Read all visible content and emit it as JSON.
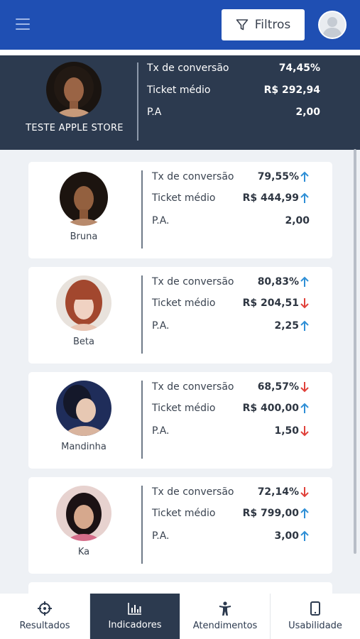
{
  "header": {
    "filter_label": "Filtros"
  },
  "store": {
    "name": "TESTE APPLE STORE",
    "metrics": [
      {
        "label": "Tx de conversão",
        "value": "74,45%"
      },
      {
        "label": "Ticket médio",
        "value": "R$ 292,94"
      },
      {
        "label": "P.A",
        "value": "2,00"
      }
    ]
  },
  "sellers": [
    {
      "name": "Bruna",
      "metrics": [
        {
          "label": "Tx de conversão",
          "value": "79,55%",
          "trend": "up"
        },
        {
          "label": "Ticket médio",
          "value": "R$ 444,99",
          "trend": "up"
        },
        {
          "label": "P.A.",
          "value": "2,00",
          "trend": "none"
        }
      ]
    },
    {
      "name": "Beta",
      "metrics": [
        {
          "label": "Tx de conversão",
          "value": "80,83%",
          "trend": "up"
        },
        {
          "label": "Ticket médio",
          "value": "R$ 204,51",
          "trend": "down"
        },
        {
          "label": "P.A.",
          "value": "2,25",
          "trend": "up"
        }
      ]
    },
    {
      "name": "Mandinha",
      "metrics": [
        {
          "label": "Tx de conversão",
          "value": "68,57%",
          "trend": "down"
        },
        {
          "label": "Ticket médio",
          "value": "R$ 400,00",
          "trend": "up"
        },
        {
          "label": "P.A.",
          "value": "1,50",
          "trend": "down"
        }
      ]
    },
    {
      "name": "Ka",
      "metrics": [
        {
          "label": "Tx de conversão",
          "value": "72,14%",
          "trend": "down"
        },
        {
          "label": "Ticket médio",
          "value": "R$ 799,00",
          "trend": "up"
        },
        {
          "label": "P.A.",
          "value": "3,00",
          "trend": "up"
        }
      ]
    }
  ],
  "bottom_nav": [
    {
      "label": "Resultados",
      "icon": "crosshair-icon",
      "active": false
    },
    {
      "label": "Indicadores",
      "icon": "bar-chart-icon",
      "active": true
    },
    {
      "label": "Atendimentos",
      "icon": "person-icon",
      "active": false
    },
    {
      "label": "Usabilidade",
      "icon": "smartphone-icon",
      "active": false
    }
  ],
  "colors": {
    "header_blue": "#1f4fb3",
    "dark_panel": "#2c3a4f",
    "trend_up": "#2f8fd6",
    "trend_down": "#e0413a"
  }
}
